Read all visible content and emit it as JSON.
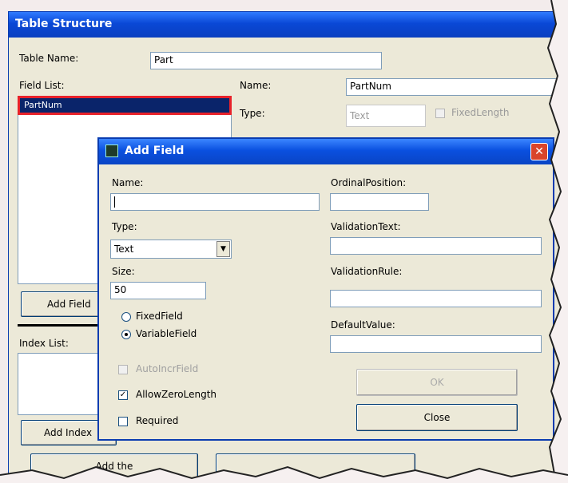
{
  "bg_window": {
    "title": "Table Structure",
    "table_name_label": "Table Name:",
    "table_name_value": "Part",
    "field_list_label": "Field List:",
    "field_list_items": [
      "PartNum"
    ],
    "name_label": "Name:",
    "name_value": "PartNum",
    "type_label": "Type:",
    "type_value": "Text",
    "fixed_length_label": "FixedLength",
    "add_field_button": "Add Field",
    "index_list_label": "Index List:",
    "add_index_button": "Add Index",
    "add_table_button": "Add the"
  },
  "dialog": {
    "title": "Add Field",
    "name_label": "Name:",
    "name_value": "",
    "type_label": "Type:",
    "type_value": "Text",
    "size_label": "Size:",
    "size_value": "50",
    "fixed_field_label": "FixedField",
    "variable_field_label": "VariableField",
    "auto_incr_label": "AutoIncrField",
    "allow_zero_length_label": "AllowZeroLength",
    "required_label": "Required",
    "ordinal_position_label": "OrdinalPosition:",
    "validation_text_label": "ValidationText:",
    "validation_rule_label": "ValidationRule:",
    "default_value_label": "DefaultValue:",
    "ok_button": "OK",
    "close_button": "Close"
  },
  "colors": {
    "titlebar": "#0a48d6",
    "close_button": "#d9442a",
    "selection": "#0a246a",
    "selection_outline": "#e8222a"
  }
}
